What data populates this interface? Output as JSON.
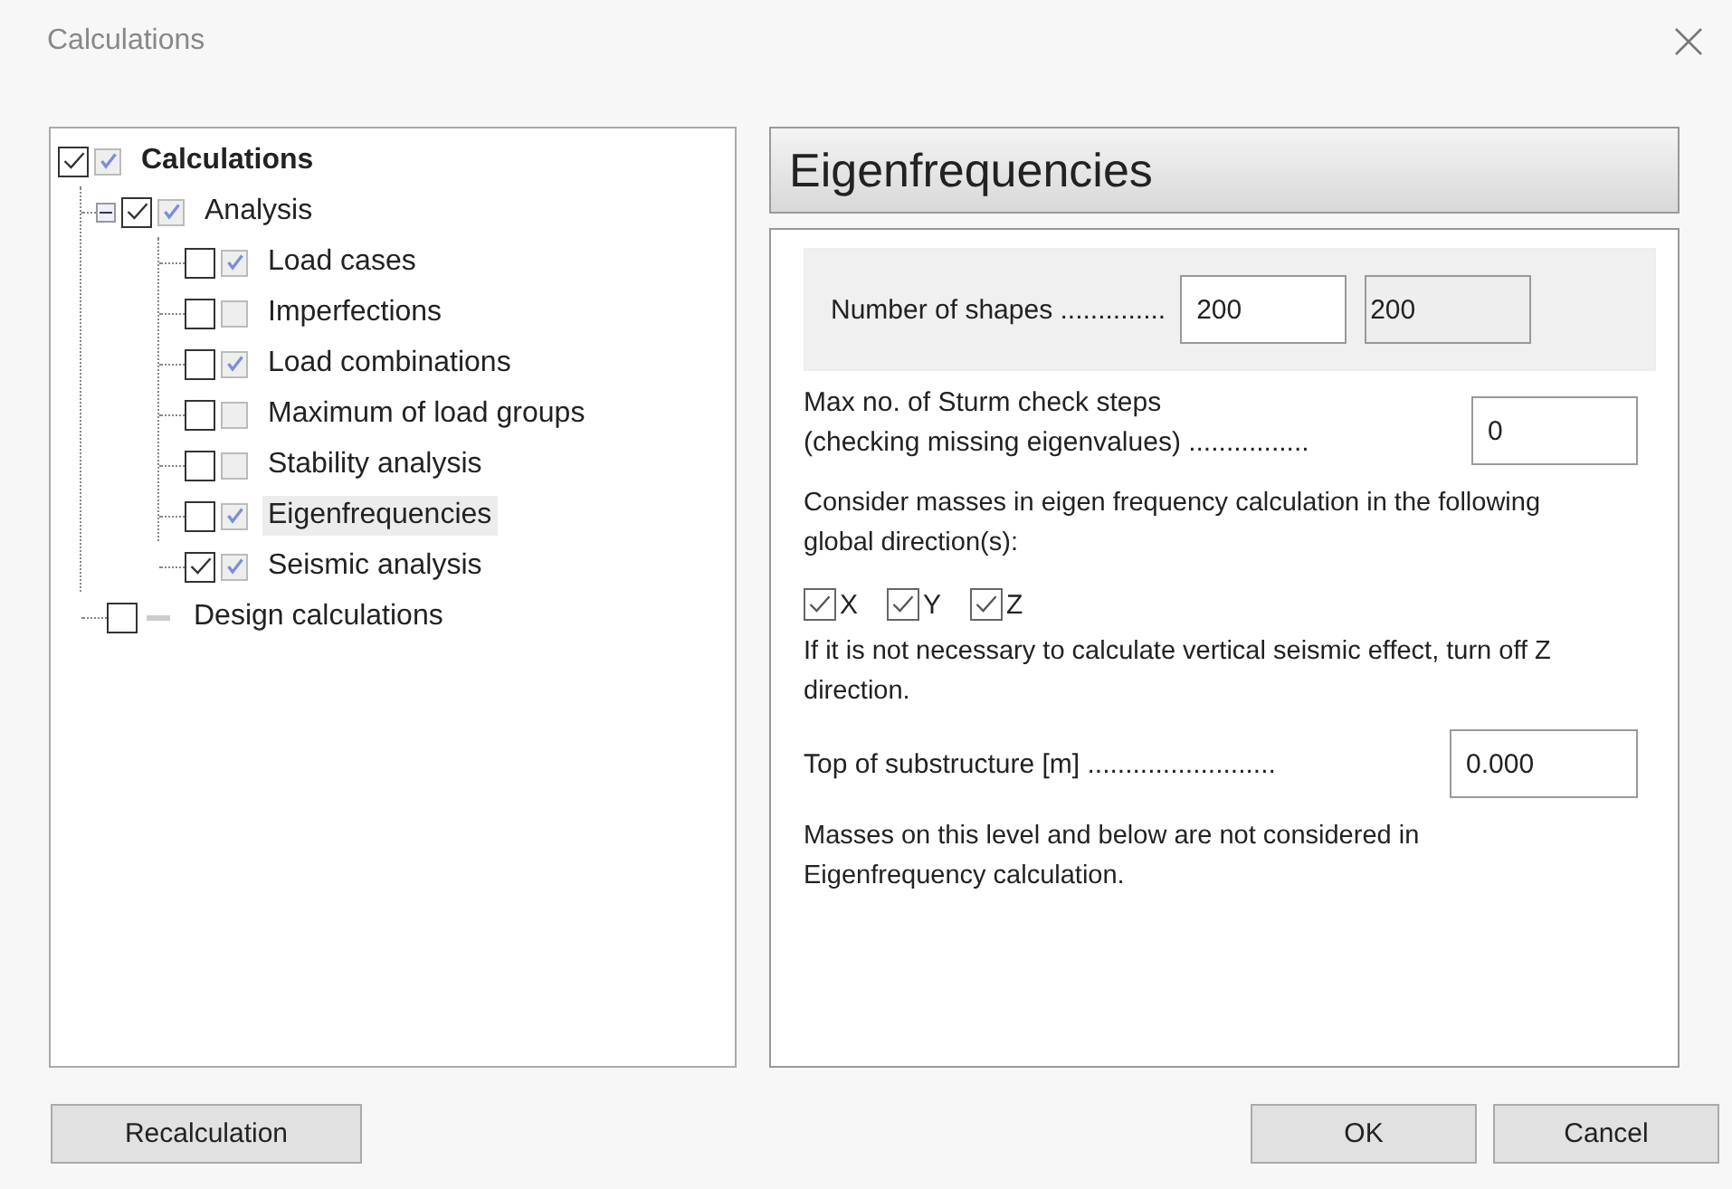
{
  "window": {
    "title": "Calculations"
  },
  "tree": [
    {
      "label": "Calculations",
      "checked": true,
      "has_status": true,
      "calculated": true,
      "selected": false,
      "children": [
        {
          "label": "Analysis",
          "checked": true,
          "has_status": true,
          "calculated": true,
          "selected": false,
          "expanded": true,
          "children": [
            {
              "label": "Load cases",
              "checked": false,
              "has_status": true,
              "calculated": true,
              "selected": false
            },
            {
              "label": "Imperfections",
              "checked": false,
              "has_status": true,
              "calculated": false,
              "selected": false
            },
            {
              "label": "Load combinations",
              "checked": false,
              "has_status": true,
              "calculated": true,
              "selected": false
            },
            {
              "label": "Maximum of load groups",
              "checked": false,
              "has_status": true,
              "calculated": false,
              "selected": false
            },
            {
              "label": "Stability analysis",
              "checked": false,
              "has_status": true,
              "calculated": false,
              "selected": false
            },
            {
              "label": "Eigenfrequencies",
              "checked": false,
              "has_status": true,
              "calculated": true,
              "selected": true
            },
            {
              "label": "Seismic analysis",
              "checked": true,
              "has_status": true,
              "calculated": true,
              "selected": false
            }
          ]
        },
        {
          "label": "Design calculations",
          "checked": false,
          "has_status": false,
          "selected": false
        }
      ]
    }
  ],
  "panel": {
    "title": "Eigenfrequencies",
    "shapes": {
      "label": "Number of shapes",
      "dots": "..............",
      "value": "200",
      "result": "200"
    },
    "sturm": {
      "line1": "Max no. of Sturm check steps",
      "line2": "(checking missing eigenvalues)",
      "dots": "................",
      "value": "0"
    },
    "masses_note": "Consider masses in eigen frequency calculation in the following global direction(s):",
    "directions": [
      {
        "label": "X",
        "checked": true
      },
      {
        "label": "Y",
        "checked": true
      },
      {
        "label": "Z",
        "checked": true
      }
    ],
    "vertical_note": "If it is not necessary to calculate vertical seismic effect, turn off Z direction.",
    "substructure": {
      "label": "Top of substructure [m]",
      "dots": ".........................",
      "value": "0.000"
    },
    "level_note": "Masses on this level and below are not considered in Eigenfrequency calculation."
  },
  "buttons": {
    "left": "Recalculation",
    "ok": "OK",
    "cancel": "Cancel"
  }
}
